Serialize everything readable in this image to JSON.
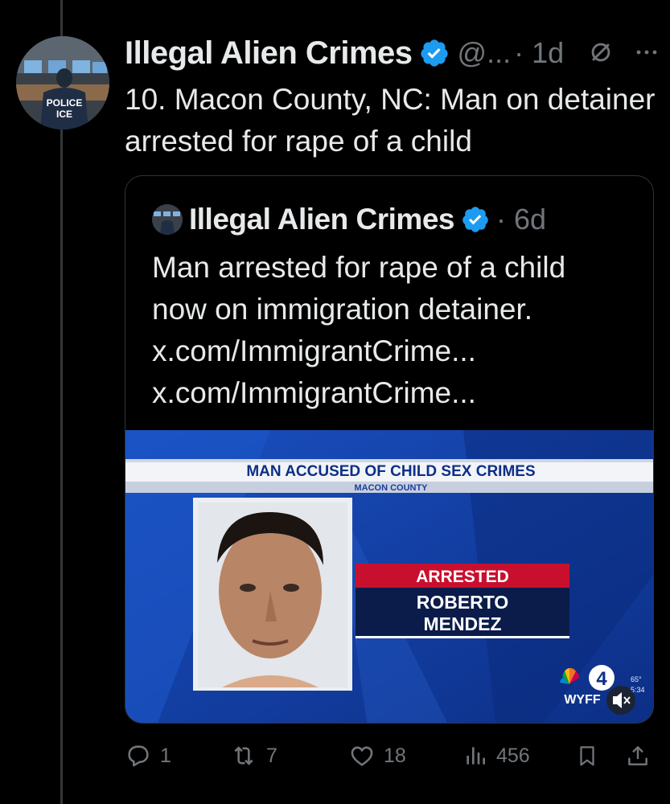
{
  "post": {
    "author_name": "Illegal Alien Crimes",
    "handle": "@...",
    "time": "· 1d",
    "text": "10. Macon County, NC: Man on detainer arrested for rape of a child",
    "avatar_text_line1": "POLICE",
    "avatar_text_line2": "ICE"
  },
  "quoted": {
    "author_name": "Illegal Alien Crimes",
    "time": "· 6d",
    "lines": [
      "Man arrested for rape of a child",
      "now on immigration detainer.",
      "x.com/ImmigrantCrime...",
      "x.com/ImmigrantCrime..."
    ],
    "media": {
      "headline": "MAN ACCUSED OF CHILD SEX CRIMES",
      "subheadline": "MACON COUNTY",
      "status": "ARRESTED",
      "person_line1": "ROBERTO",
      "person_line2": "MENDEZ",
      "station": "WYFF",
      "channel": "4",
      "temperature": "65°",
      "clock": "5:34"
    }
  },
  "actions": {
    "replies": "1",
    "reposts": "7",
    "likes": "18",
    "views": "456"
  },
  "colors": {
    "verified": "#1d9bf0",
    "muted_text": "#71767b",
    "news_blue": "#1440a8",
    "news_red": "#c8102e"
  },
  "icons": [
    "verified-badge-icon",
    "grok-icon",
    "more-icon",
    "reply-icon",
    "repost-icon",
    "like-icon",
    "views-icon",
    "bookmark-icon",
    "share-icon",
    "mute-icon"
  ]
}
